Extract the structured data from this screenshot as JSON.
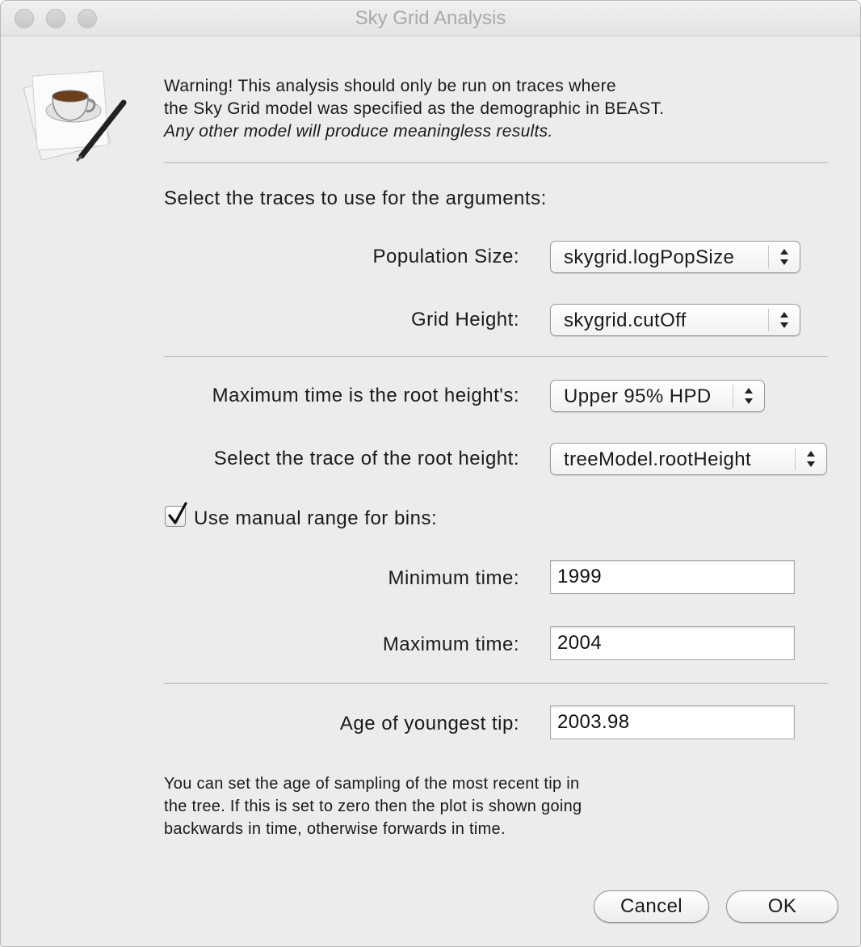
{
  "window": {
    "title": "Sky Grid Analysis"
  },
  "warning": {
    "line1": "Warning! This analysis should only be run on traces where",
    "line2": "the Sky Grid model was specified as the demographic in BEAST.",
    "line3": "Any other model will produce meaningless results."
  },
  "select_traces_heading": "Select the traces to use for the arguments:",
  "population_size": {
    "label": "Population Size:",
    "value": "skygrid.logPopSize"
  },
  "grid_height": {
    "label": "Grid Height:",
    "value": "skygrid.cutOff"
  },
  "max_time_root": {
    "label": "Maximum time is the root height's:",
    "value": "Upper 95% HPD"
  },
  "root_height_trace": {
    "label": "Select the trace of the root height:",
    "value": "treeModel.rootHeight"
  },
  "manual_range": {
    "label": "Use manual range for bins:",
    "checked": true
  },
  "minimum_time": {
    "label": "Minimum time:",
    "value": "1999"
  },
  "maximum_time": {
    "label": "Maximum time:",
    "value": "2004"
  },
  "youngest_tip": {
    "label": "Age of youngest tip:",
    "value": "2003.98"
  },
  "info": {
    "line1": "You can set the age of sampling of the most recent tip in",
    "line2": "the tree. If this is set to zero then the plot is shown going",
    "line3": "backwards in time, otherwise forwards in time."
  },
  "buttons": {
    "cancel": "Cancel",
    "ok": "OK"
  },
  "icons": {
    "app": "coffee-cup-pen-icon",
    "dropdown": "updown-arrows-icon",
    "check": "checkmark-icon"
  }
}
